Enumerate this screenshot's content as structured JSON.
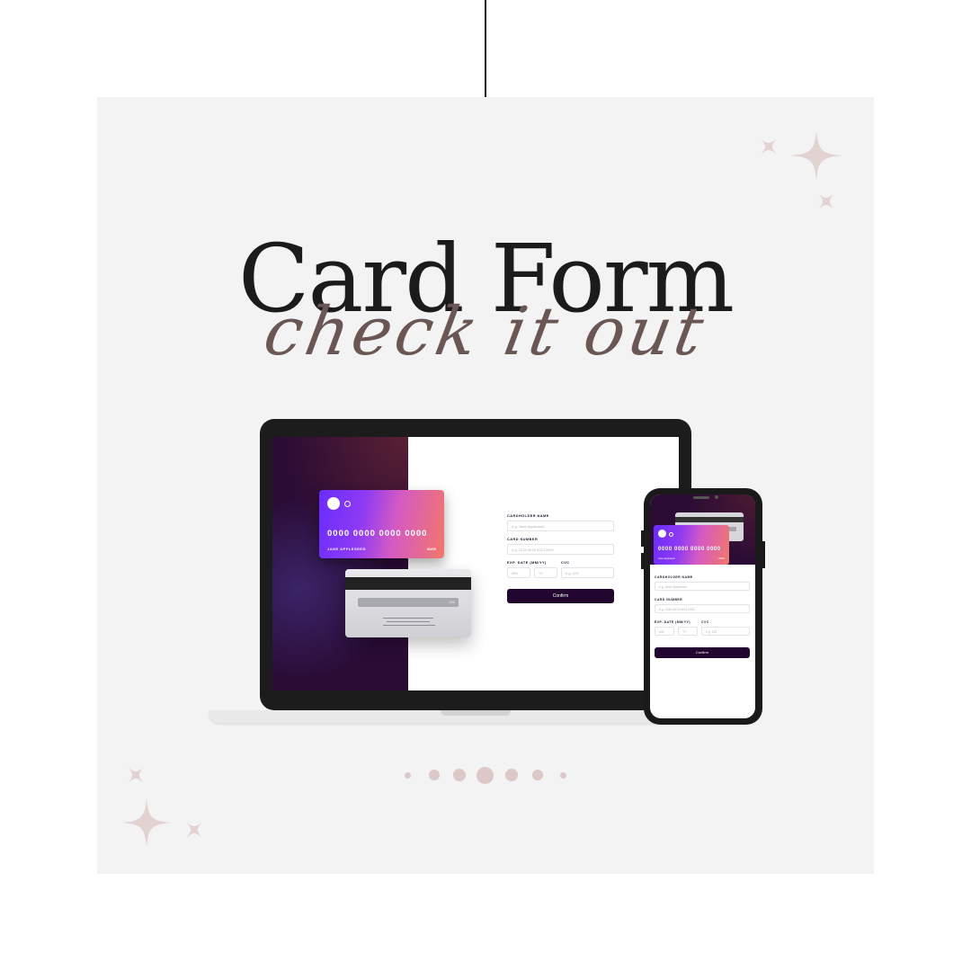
{
  "title": "Card Form",
  "subtitle": "check it out",
  "colors": {
    "panel": "#f3f3f3",
    "accent_text": "#6b5656",
    "sparkle": "#e2d2d2",
    "dark_button": "#22062f",
    "card_gradient": [
      "#6a2cff",
      "#d45ac4",
      "#f2776a"
    ]
  },
  "laptop": {
    "card_front": {
      "number": "0000 0000 0000 0000",
      "name": "JANE APPLESEED",
      "expiry": "00/00"
    },
    "card_back": {
      "cvc": "000"
    },
    "form": {
      "name_label": "CARDHOLDER NAME",
      "name_placeholder": "e.g. Jane Appleseed",
      "number_label": "CARD NUMBER",
      "number_placeholder": "e.g. 1234 5678 9123 0000",
      "exp_label": "EXP. DATE (MM/YY)",
      "mm_placeholder": "MM",
      "yy_placeholder": "YY",
      "cvc_label": "CVC",
      "cvc_placeholder": "e.g. 123",
      "confirm": "Confirm"
    }
  },
  "phone": {
    "card_front": {
      "number": "0000 0000 0000 0000",
      "name": "Jane Appleseed",
      "expiry": "00/00"
    },
    "form": {
      "name_label": "CARDHOLDER NAME",
      "name_placeholder": "e.g. Jane Appleseed",
      "number_label": "CARD NUMBER",
      "number_placeholder": "e.g. 1234 5678 9123 0000",
      "exp_label": "EXP. DATE (MM/YY)",
      "mm_placeholder": "MM",
      "yy_placeholder": "YY",
      "cvc_label": "CVC",
      "cvc_placeholder": "e.g. 123",
      "confirm": "Confirm"
    }
  },
  "pagination": {
    "count": 7,
    "active_index": 3
  },
  "icons": [
    "sparkle-icon"
  ]
}
